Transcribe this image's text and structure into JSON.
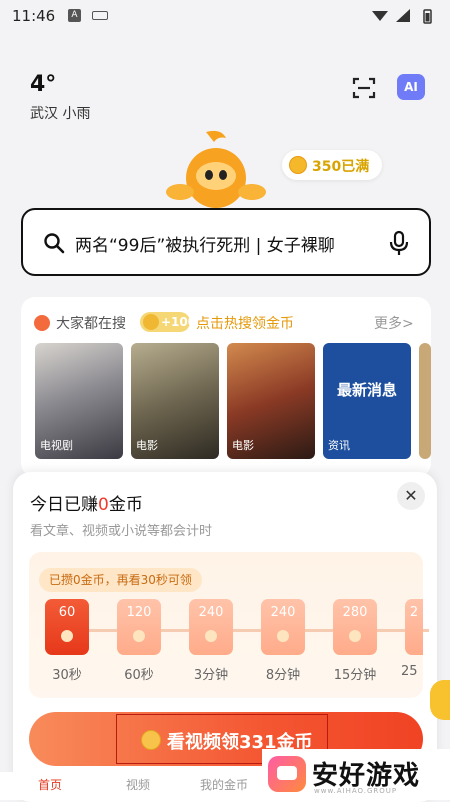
{
  "status_bar": {
    "time": "11:46",
    "a_label": "A"
  },
  "weather": {
    "temp": "4°",
    "location": "武汉 小雨"
  },
  "header": {
    "ai_label": "AI"
  },
  "coins": {
    "balance": "350已满"
  },
  "search": {
    "query": "两名“99后”被执行死刑 | 女子裸聊"
  },
  "trending": {
    "title": "大家都在搜",
    "reward_badge": "+100",
    "reward_text": "点击热搜领金币",
    "more": "更多>",
    "items": [
      {
        "tag": "电视剧"
      },
      {
        "tag": "电影"
      },
      {
        "tag": "电影"
      },
      {
        "tag": "资讯",
        "headline": "最新消息"
      }
    ]
  },
  "earn_panel": {
    "title_prefix": "今日已赚",
    "amount": "0",
    "title_suffix": "金币",
    "subtitle": "看文章、视频或小说等都会计时",
    "progress_tip": "已攒0金币，再看30秒可领",
    "steps": [
      {
        "amount": "60",
        "label": "30秒"
      },
      {
        "amount": "120",
        "label": "60秒"
      },
      {
        "amount": "240",
        "label": "3分钟"
      },
      {
        "amount": "240",
        "label": "8分钟"
      },
      {
        "amount": "280",
        "label": "15分钟"
      },
      {
        "amount": "2",
        "label": "25"
      }
    ],
    "close": "✕",
    "watch_button": "看视频领331金币"
  },
  "bottom_nav": [
    "首页",
    "视频",
    "我的金币"
  ],
  "watermark": {
    "brand": "安好游戏",
    "small": "www.AIHAO.GROUP"
  }
}
